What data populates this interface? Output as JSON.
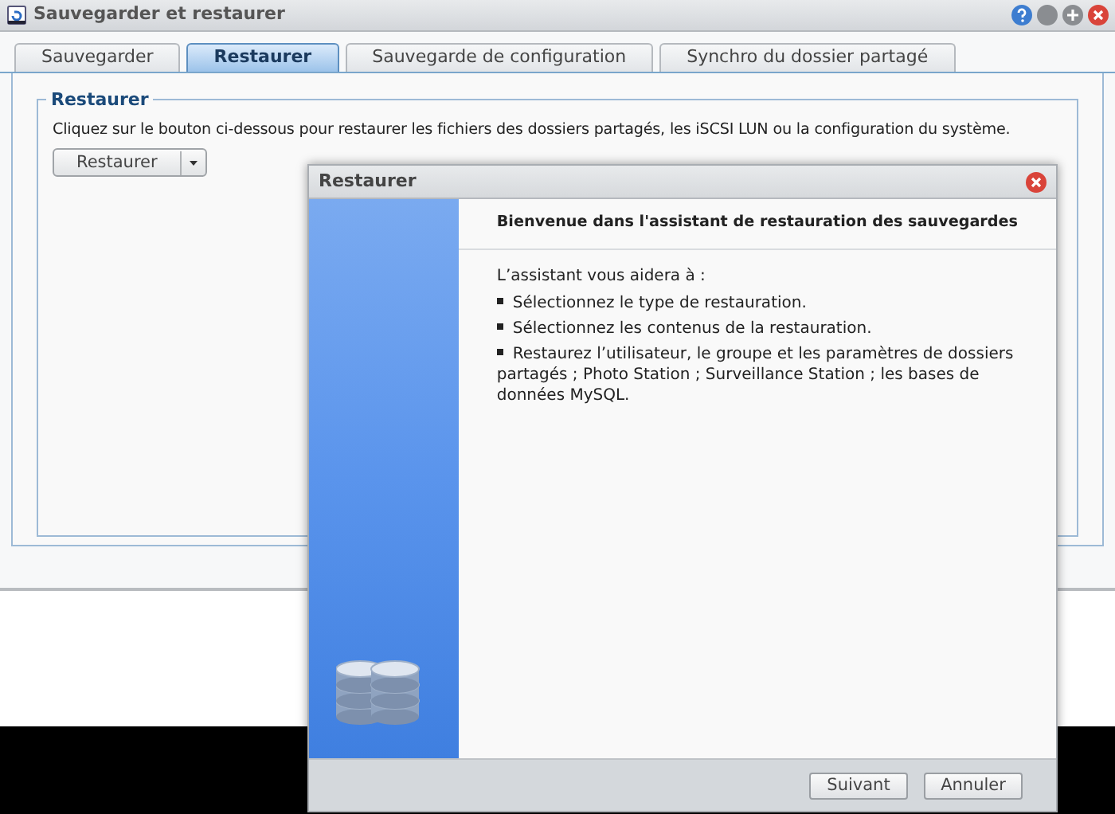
{
  "window": {
    "title": "Sauvegarder et restaurer"
  },
  "tabs": [
    {
      "label": "Sauvegarder",
      "selected": false
    },
    {
      "label": "Restaurer",
      "selected": true
    },
    {
      "label": "Sauvegarde de configuration",
      "selected": false
    },
    {
      "label": "Synchro du dossier partagé",
      "selected": false
    }
  ],
  "section": {
    "legend": "Restaurer",
    "description": "Cliquez sur le bouton ci-dessous pour restaurer les fichiers des dossiers partagés, les iSCSI LUN ou la configuration du système.",
    "button": "Restaurer"
  },
  "dialog": {
    "title": "Restaurer",
    "heading": "Bienvenue dans l'assistant de restauration des sauvegardes",
    "intro": "L’assistant vous aidera à :",
    "steps": [
      "Sélectionnez le type de restauration.",
      "Sélectionnez les contenus de la restauration.",
      "Restaurez l’utilisateur, le groupe et les paramètres de dossiers partagés ; Photo Station ; Surveillance Station ; les bases de données MySQL."
    ],
    "buttons": [
      "Suivant",
      "Annuler"
    ]
  }
}
